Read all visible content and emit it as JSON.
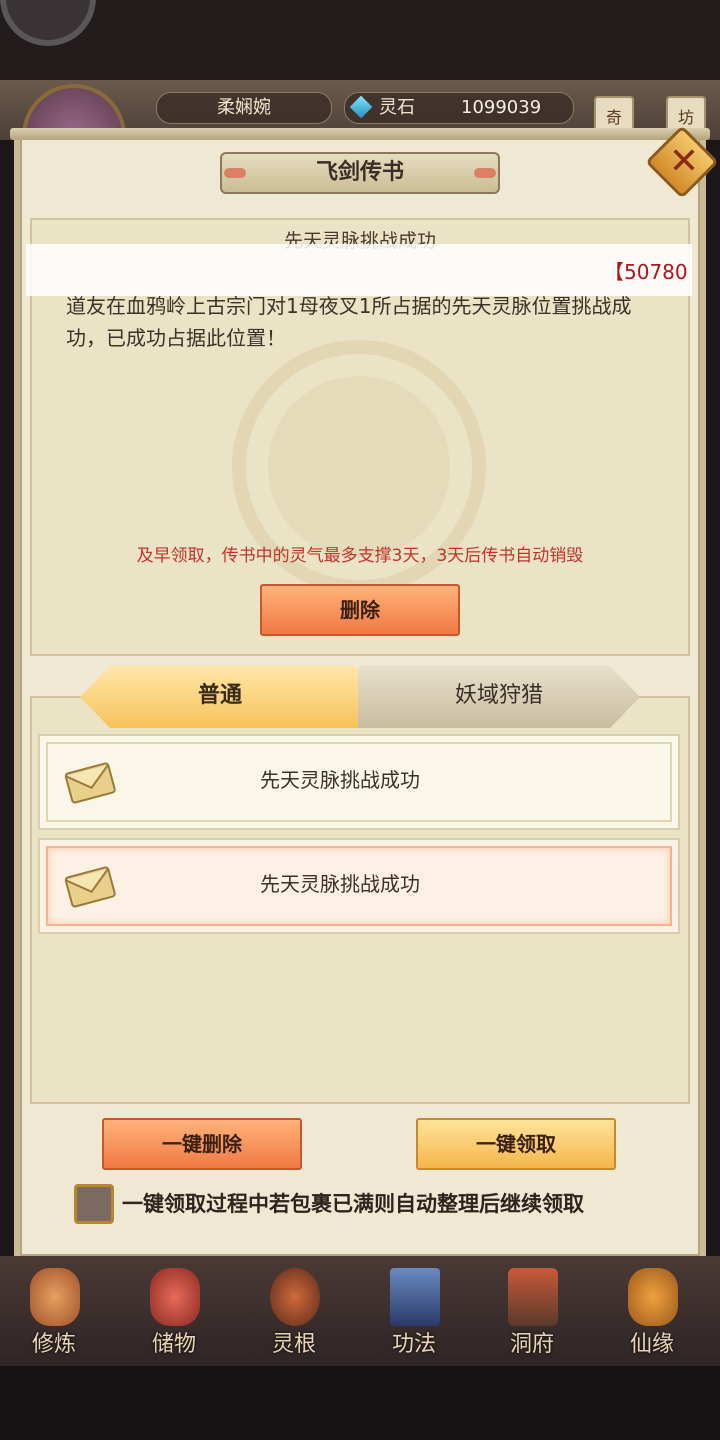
{
  "header": {
    "player_name": "柔娴婉",
    "currency_label": "灵石",
    "currency_value": "1099039",
    "side_buttons": [
      "奇",
      "坊"
    ]
  },
  "panel": {
    "title": "飞剑传书",
    "close_symbol": "✕"
  },
  "message": {
    "title": "先天灵脉挑战成功",
    "body": "道友在血鸦岭上古宗门对1母夜叉1所占据的先天灵脉位置挑战成功，已成功占据此位置！",
    "warning": "及早领取，传书中的灵气最多支撑3天，3天后传书自动销毁",
    "delete_label": "删除"
  },
  "toast": {
    "text": "【50780"
  },
  "tabs": [
    {
      "label": "普通",
      "active": true
    },
    {
      "label": "妖域狩猎",
      "active": false
    }
  ],
  "mail_list": [
    {
      "title": "先天灵脉挑战成功",
      "selected": false
    },
    {
      "title": "先天灵脉挑战成功",
      "selected": true
    }
  ],
  "actions": {
    "delete_all_label": "一键删除",
    "claim_all_label": "一键领取",
    "auto_sort_label": "一键领取过程中若包裹已满则自动整理后继续领取",
    "auto_sort_checked": false
  },
  "bottom_nav": [
    {
      "label": "修炼",
      "icon": "monk-icon"
    },
    {
      "label": "储物",
      "icon": "storage-bag-icon"
    },
    {
      "label": "灵根",
      "icon": "spirit-root-icon"
    },
    {
      "label": "功法",
      "icon": "book-icon"
    },
    {
      "label": "洞府",
      "icon": "cave-gate-icon"
    },
    {
      "label": "仙缘",
      "icon": "fortune-icon"
    }
  ],
  "colors": {
    "accent_orange": "#f07a44",
    "accent_gold": "#f4b64a",
    "warning_red": "#c0342a",
    "toast_red": "#b0141c"
  }
}
